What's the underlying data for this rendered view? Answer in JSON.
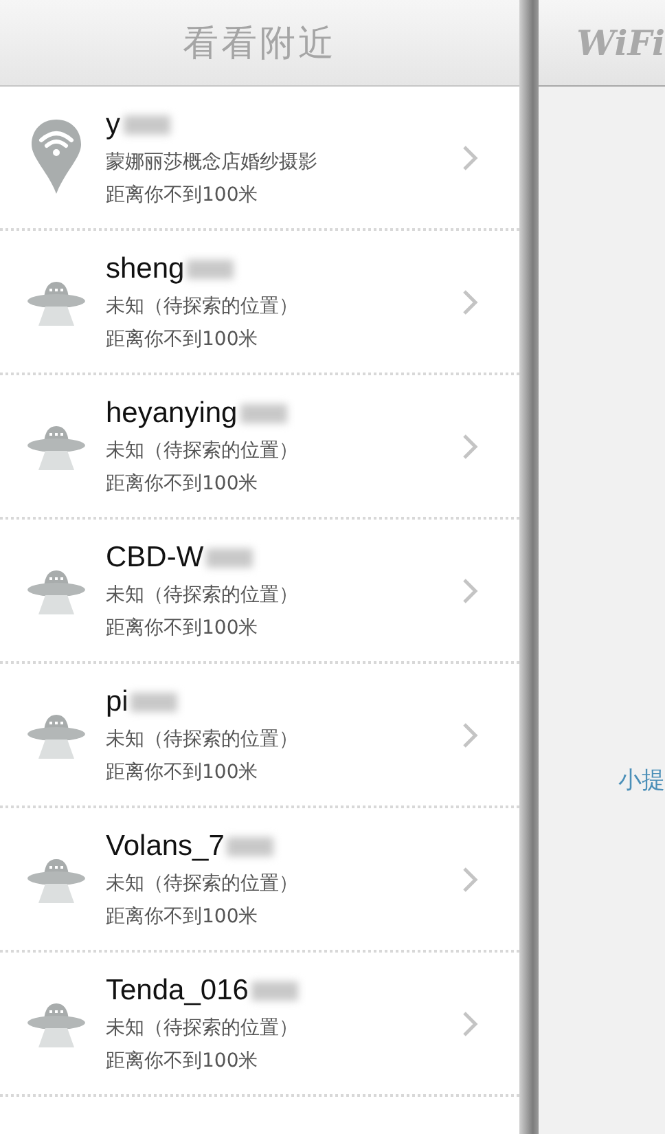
{
  "left_panel": {
    "title": "看看附近",
    "items": [
      {
        "kind": "wifi",
        "name": "y",
        "location": "蒙娜丽莎概念店婚纱摄影",
        "distance": "距离你不到100米"
      },
      {
        "kind": "unknown",
        "name": "sheng",
        "location": "未知（待探索的位置）",
        "distance": "距离你不到100米"
      },
      {
        "kind": "unknown",
        "name": "heyanying",
        "location": "未知（待探索的位置）",
        "distance": "距离你不到100米"
      },
      {
        "kind": "unknown",
        "name": "CBD-W",
        "location": "未知（待探索的位置）",
        "distance": "距离你不到100米"
      },
      {
        "kind": "unknown",
        "name": "pi",
        "location": "未知（待探索的位置）",
        "distance": "距离你不到100米"
      },
      {
        "kind": "unknown",
        "name": "Volans_7",
        "location": "未知（待探索的位置）",
        "distance": "距离你不到100米"
      },
      {
        "kind": "unknown",
        "name": "Tenda_016",
        "location": "未知（待探索的位置）",
        "distance": "距离你不到100米"
      }
    ]
  },
  "right_panel": {
    "title": "WiFi",
    "tip": "小提"
  }
}
